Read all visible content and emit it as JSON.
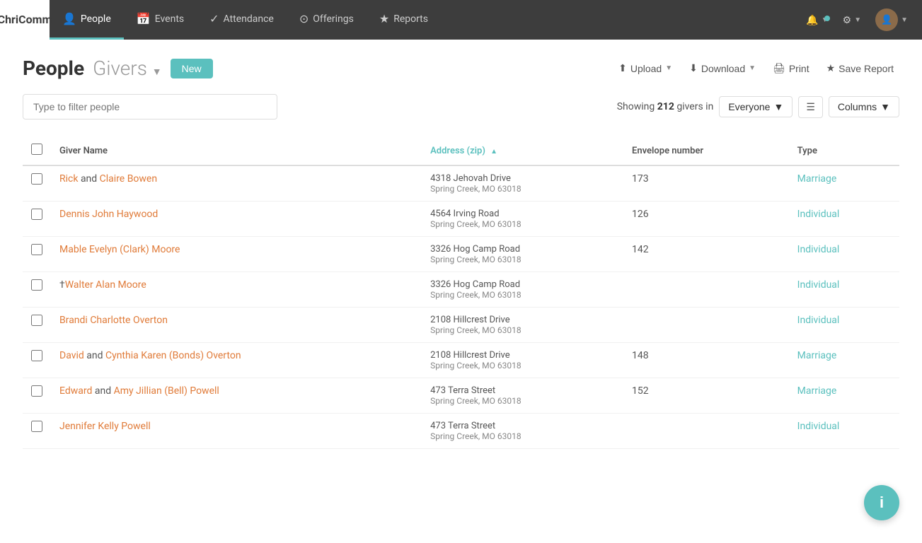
{
  "app": {
    "logo_line1": "Chri",
    "logo_line2": "Comm"
  },
  "navbar": {
    "items": [
      {
        "id": "people",
        "label": "People",
        "icon": "👤",
        "active": true
      },
      {
        "id": "events",
        "label": "Events",
        "icon": "📅",
        "active": false
      },
      {
        "id": "attendance",
        "label": "Attendance",
        "icon": "✓",
        "active": false
      },
      {
        "id": "offerings",
        "label": "Offerings",
        "icon": "⊙",
        "active": false
      },
      {
        "id": "reports",
        "label": "Reports",
        "icon": "★",
        "active": false
      }
    ]
  },
  "page": {
    "title_bold": "People",
    "title_light": "Givers",
    "title_arrow": "▼",
    "new_button": "New",
    "upload_button": "Upload",
    "download_button": "Download",
    "print_button": "Print",
    "save_report_button": "Save Report",
    "filter_placeholder": "Type to filter people",
    "showing_prefix": "Showing",
    "showing_count": "212",
    "showing_suffix": "givers in",
    "everyone_label": "Everyone",
    "columns_label": "Columns",
    "table": {
      "headers": [
        {
          "id": "giver_name",
          "label": "Giver Name",
          "sortable": false
        },
        {
          "id": "address_zip",
          "label": "Address (zip)",
          "sortable": true
        },
        {
          "id": "envelope_number",
          "label": "Envelope number",
          "sortable": false
        },
        {
          "id": "type",
          "label": "Type",
          "sortable": false
        }
      ],
      "rows": [
        {
          "id": 1,
          "giver_name_parts": [
            {
              "text": "Rick",
              "link": true
            },
            {
              "text": " and ",
              "link": false
            },
            {
              "text": "Claire Bowen",
              "link": true
            }
          ],
          "address1": "4318 Jehovah Drive",
          "address2": "Spring Creek, MO   63018",
          "envelope": "173",
          "type": "Marriage"
        },
        {
          "id": 2,
          "giver_name_parts": [
            {
              "text": "Dennis John Haywood",
              "link": true
            }
          ],
          "address1": "4564 Irving Road",
          "address2": "Spring Creek, MO   63018",
          "envelope": "126",
          "type": "Individual"
        },
        {
          "id": 3,
          "giver_name_parts": [
            {
              "text": "Mable Evelyn (Clark) Moore",
              "link": true
            }
          ],
          "address1": "3326 Hog Camp Road",
          "address2": "Spring Creek, MO   63018",
          "envelope": "142",
          "type": "Individual"
        },
        {
          "id": 4,
          "giver_name_parts": [
            {
              "text": "†",
              "link": false,
              "dagger": true
            },
            {
              "text": "Walter Alan Moore",
              "link": true
            }
          ],
          "address1": "3326 Hog Camp Road",
          "address2": "Spring Creek, MO   63018",
          "envelope": "",
          "type": "Individual"
        },
        {
          "id": 5,
          "giver_name_parts": [
            {
              "text": "Brandi Charlotte Overton",
              "link": true
            }
          ],
          "address1": "2108 Hillcrest Drive",
          "address2": "Spring Creek, MO   63018",
          "envelope": "",
          "type": "Individual"
        },
        {
          "id": 6,
          "giver_name_parts": [
            {
              "text": "David",
              "link": true
            },
            {
              "text": " and ",
              "link": false
            },
            {
              "text": "Cynthia Karen (Bonds) Overton",
              "link": true
            }
          ],
          "address1": "2108 Hillcrest Drive",
          "address2": "Spring Creek, MO   63018",
          "envelope": "148",
          "type": "Marriage"
        },
        {
          "id": 7,
          "giver_name_parts": [
            {
              "text": "Edward",
              "link": true
            },
            {
              "text": " and ",
              "link": false
            },
            {
              "text": "Amy Jillian (Bell) Powell",
              "link": true
            }
          ],
          "address1": "473 Terra Street",
          "address2": "Spring Creek, MO   63018",
          "envelope": "152",
          "type": "Marriage"
        },
        {
          "id": 8,
          "giver_name_parts": [
            {
              "text": "Jennifer Kelly Powell",
              "link": true
            }
          ],
          "address1": "473 Terra Street",
          "address2": "Spring Creek, MO   63018",
          "envelope": "",
          "type": "Individual"
        }
      ]
    }
  }
}
